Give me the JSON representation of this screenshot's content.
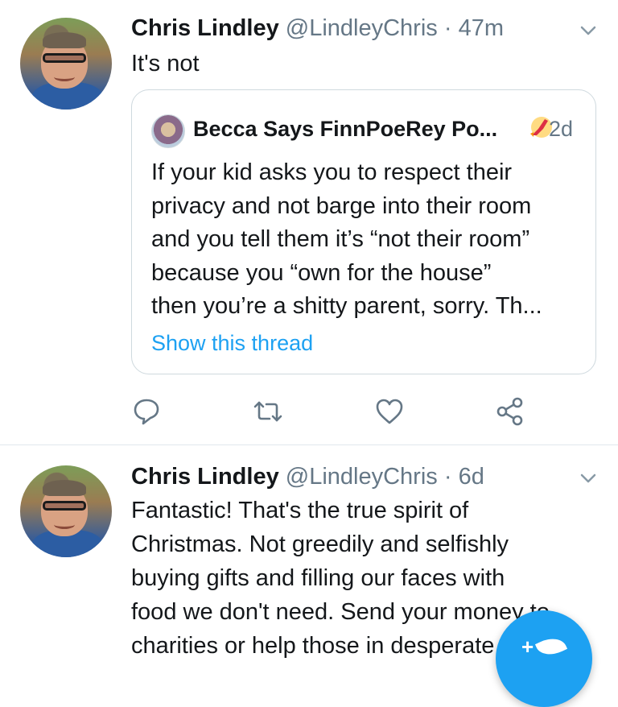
{
  "tweets": [
    {
      "author": {
        "name": "Chris Lindley",
        "handle": "@LindleyChris"
      },
      "separator": "·",
      "time": "47m",
      "text": "It's not",
      "quoted": {
        "author_name": "Becca Says FinnPoeRey Po...",
        "time": "2d",
        "lines": [
          "If your kid asks you to respect their",
          "privacy and not barge into their room",
          "and you tell them it’s “not their room”",
          "because you “own for the house”",
          "then you’re a shitty parent, sorry. Th..."
        ],
        "link_label": "Show this thread"
      },
      "actions": [
        {
          "name": "reply",
          "icon": "reply-icon"
        },
        {
          "name": "retweet",
          "icon": "retweet-icon"
        },
        {
          "name": "like",
          "icon": "heart-icon"
        },
        {
          "name": "share",
          "icon": "share-icon"
        }
      ]
    },
    {
      "author": {
        "name": "Chris Lindley",
        "handle": "@LindleyChris"
      },
      "separator": "·",
      "time": "6d",
      "lines": [
        "Fantastic! That's the true spirit of",
        "Christmas. Not greedily and selfishly",
        "buying gifts and filling our faces with",
        "food we don't need. Send your money to",
        "charities or help those in desperate need"
      ]
    }
  ],
  "compose_button": {
    "icon": "compose-tweet-icon",
    "plus": "+"
  },
  "colors": {
    "accent": "#1da1f2",
    "secondary_text": "#657786",
    "border": "#cfd9de"
  }
}
